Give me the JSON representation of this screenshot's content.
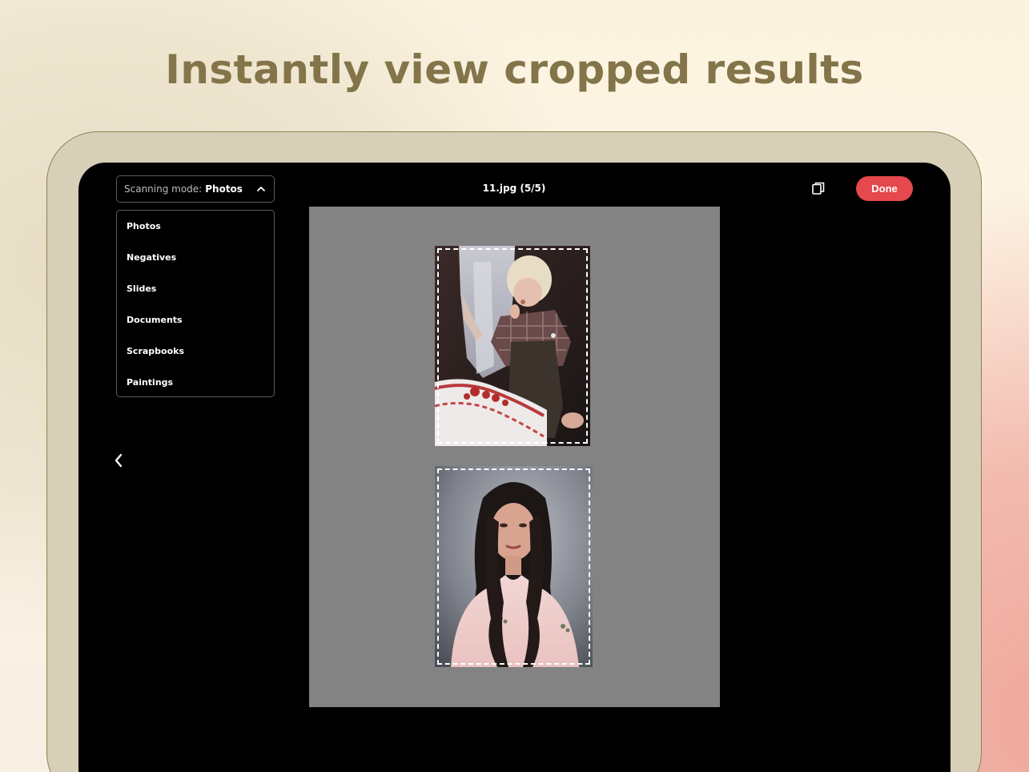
{
  "headline": "Instantly view cropped results",
  "toolbar": {
    "mode_label": "Scanning mode:",
    "mode_value": "Photos",
    "filename": "11.jpg (5/5)",
    "done_label": "Done",
    "copy_icon": "copy-icon",
    "chevron_icon": "chevron-up-icon"
  },
  "mode_menu": {
    "items": [
      {
        "label": "Photos"
      },
      {
        "label": "Negatives"
      },
      {
        "label": "Slides"
      },
      {
        "label": "Documents"
      },
      {
        "label": "Scrapbooks"
      },
      {
        "label": "Paintings"
      }
    ]
  },
  "navigation": {
    "back_icon": "chevron-left-icon"
  },
  "scan": {
    "crops": [
      {
        "subject": "toddler-with-birthday-cake-photo"
      },
      {
        "subject": "portrait-of-young-woman-photo"
      }
    ]
  },
  "colors": {
    "accent_done": "#e5484d",
    "headline": "#84744a",
    "device_bezel": "#d8cfb8",
    "scan_background": "#838383"
  }
}
